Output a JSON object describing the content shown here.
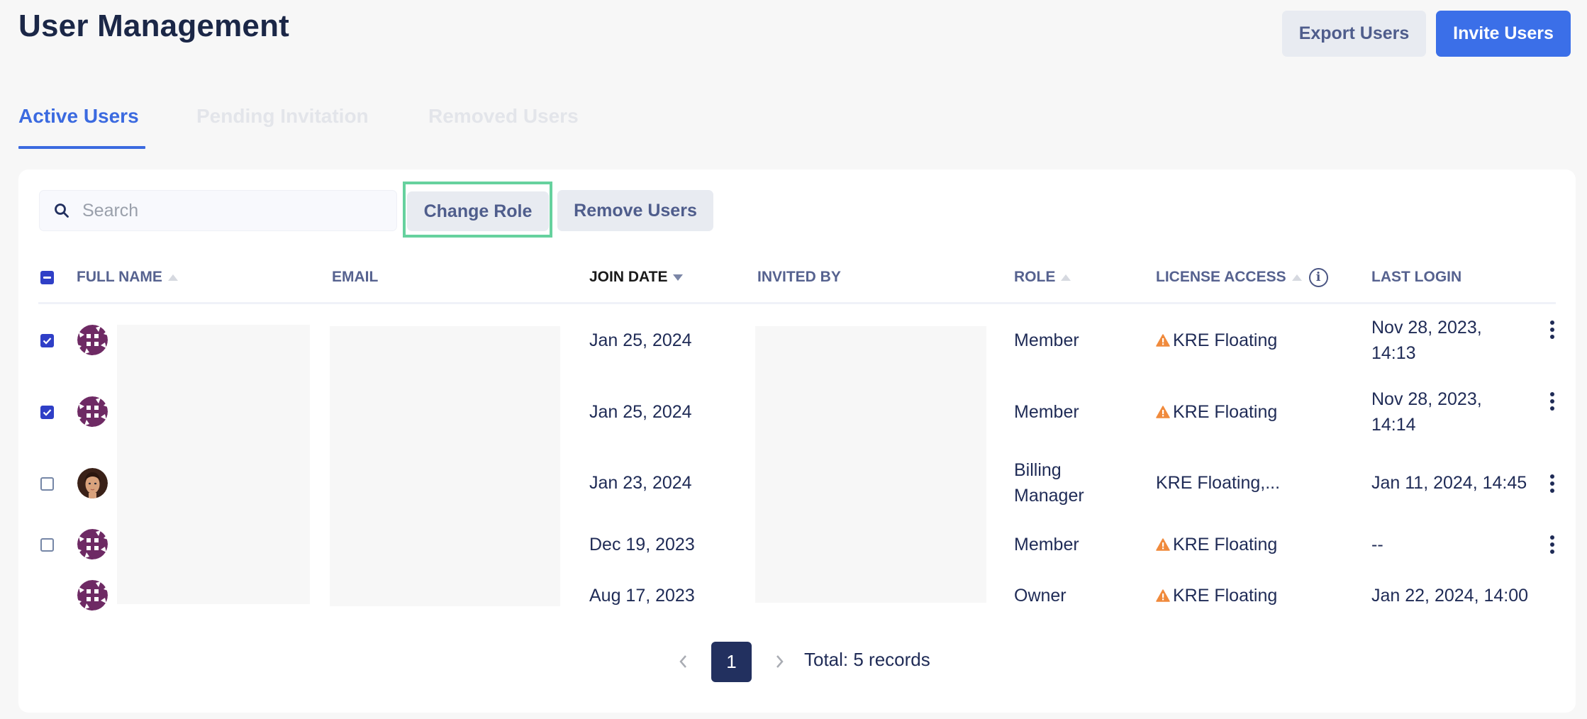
{
  "header": {
    "title": "User Management",
    "export_label": "Export Users",
    "invite_label": "Invite Users"
  },
  "tabs": [
    {
      "label": "Active Users",
      "active": true
    },
    {
      "label": "Pending Invitation",
      "active": false
    },
    {
      "label": "Removed Users",
      "active": false
    }
  ],
  "toolbar": {
    "search_placeholder": "Search",
    "search_value": "",
    "change_role_label": "Change Role",
    "remove_users_label": "Remove Users"
  },
  "table": {
    "select_all_state": "partial",
    "columns": [
      {
        "key": "full_name",
        "label": "FULL NAME",
        "sort": "asc-inactive"
      },
      {
        "key": "email",
        "label": "EMAIL",
        "sort": "none"
      },
      {
        "key": "join_date",
        "label": "JOIN DATE",
        "sort": "desc-active"
      },
      {
        "key": "invited_by",
        "label": "INVITED BY",
        "sort": "none"
      },
      {
        "key": "role",
        "label": "ROLE",
        "sort": "asc-inactive"
      },
      {
        "key": "license_access",
        "label": "LICENSE ACCESS",
        "sort": "asc-inactive",
        "info_icon": true
      },
      {
        "key": "last_login",
        "label": "LAST LOGIN",
        "sort": "none"
      }
    ],
    "rows": [
      {
        "checked": true,
        "avatar": "identicon",
        "full_name": "",
        "email": "",
        "join_date": "Jan 25, 2024",
        "invited_by": "",
        "role": "Member",
        "license_warning": true,
        "license_access": "KRE Floating",
        "last_login_1": "Nov 28, 2023,",
        "last_login_2": "14:13",
        "has_menu": true
      },
      {
        "checked": true,
        "avatar": "identicon",
        "full_name": "",
        "email": "",
        "join_date": "Jan 25, 2024",
        "invited_by": "",
        "role": "Member",
        "license_warning": true,
        "license_access": "KRE Floating",
        "last_login_1": "Nov 28, 2023,",
        "last_login_2": "14:14",
        "has_menu": true
      },
      {
        "checked": false,
        "avatar": "photo",
        "full_name": "",
        "email": "",
        "join_date": "Jan 23, 2024",
        "invited_by": "",
        "role_1": "Billing",
        "role_2": "Manager",
        "license_warning": false,
        "license_access": "KRE Floating,...",
        "last_login": "Jan 11, 2024, 14:45",
        "has_menu": true
      },
      {
        "checked": false,
        "avatar": "identicon",
        "full_name": "",
        "email": "",
        "join_date": "Dec 19, 2023",
        "invited_by": "",
        "role": "Member",
        "license_warning": true,
        "license_access": "KRE Floating",
        "last_login": "--",
        "has_menu": true
      },
      {
        "checked": false,
        "avatar": "identicon",
        "full_name": "",
        "email": "",
        "join_date": "Aug 17, 2023",
        "invited_by": "",
        "role": "Owner",
        "license_warning": true,
        "license_access": "KRE Floating",
        "last_login": "Jan 22, 2024, 14:00",
        "has_menu": false
      }
    ]
  },
  "pagination": {
    "current_page": "1",
    "total_label": "Total: 5 records"
  },
  "colors": {
    "accent": "#3b6fe8",
    "title": "#1b2747",
    "text": "#1f2b56",
    "checkbox": "#2f3fc7",
    "warning": "#f08a3c",
    "focus_ring": "#66d19e",
    "identicon": "#6e2a64",
    "page_active": "#22305f"
  },
  "icons": {
    "search": "search-icon",
    "sort_asc": "sort-up-icon",
    "sort_desc": "sort-down-icon",
    "info": "info-icon",
    "warning": "warning-icon",
    "kebab": "more-vertical-icon",
    "prev": "chevron-left-icon",
    "next": "chevron-right-icon"
  }
}
